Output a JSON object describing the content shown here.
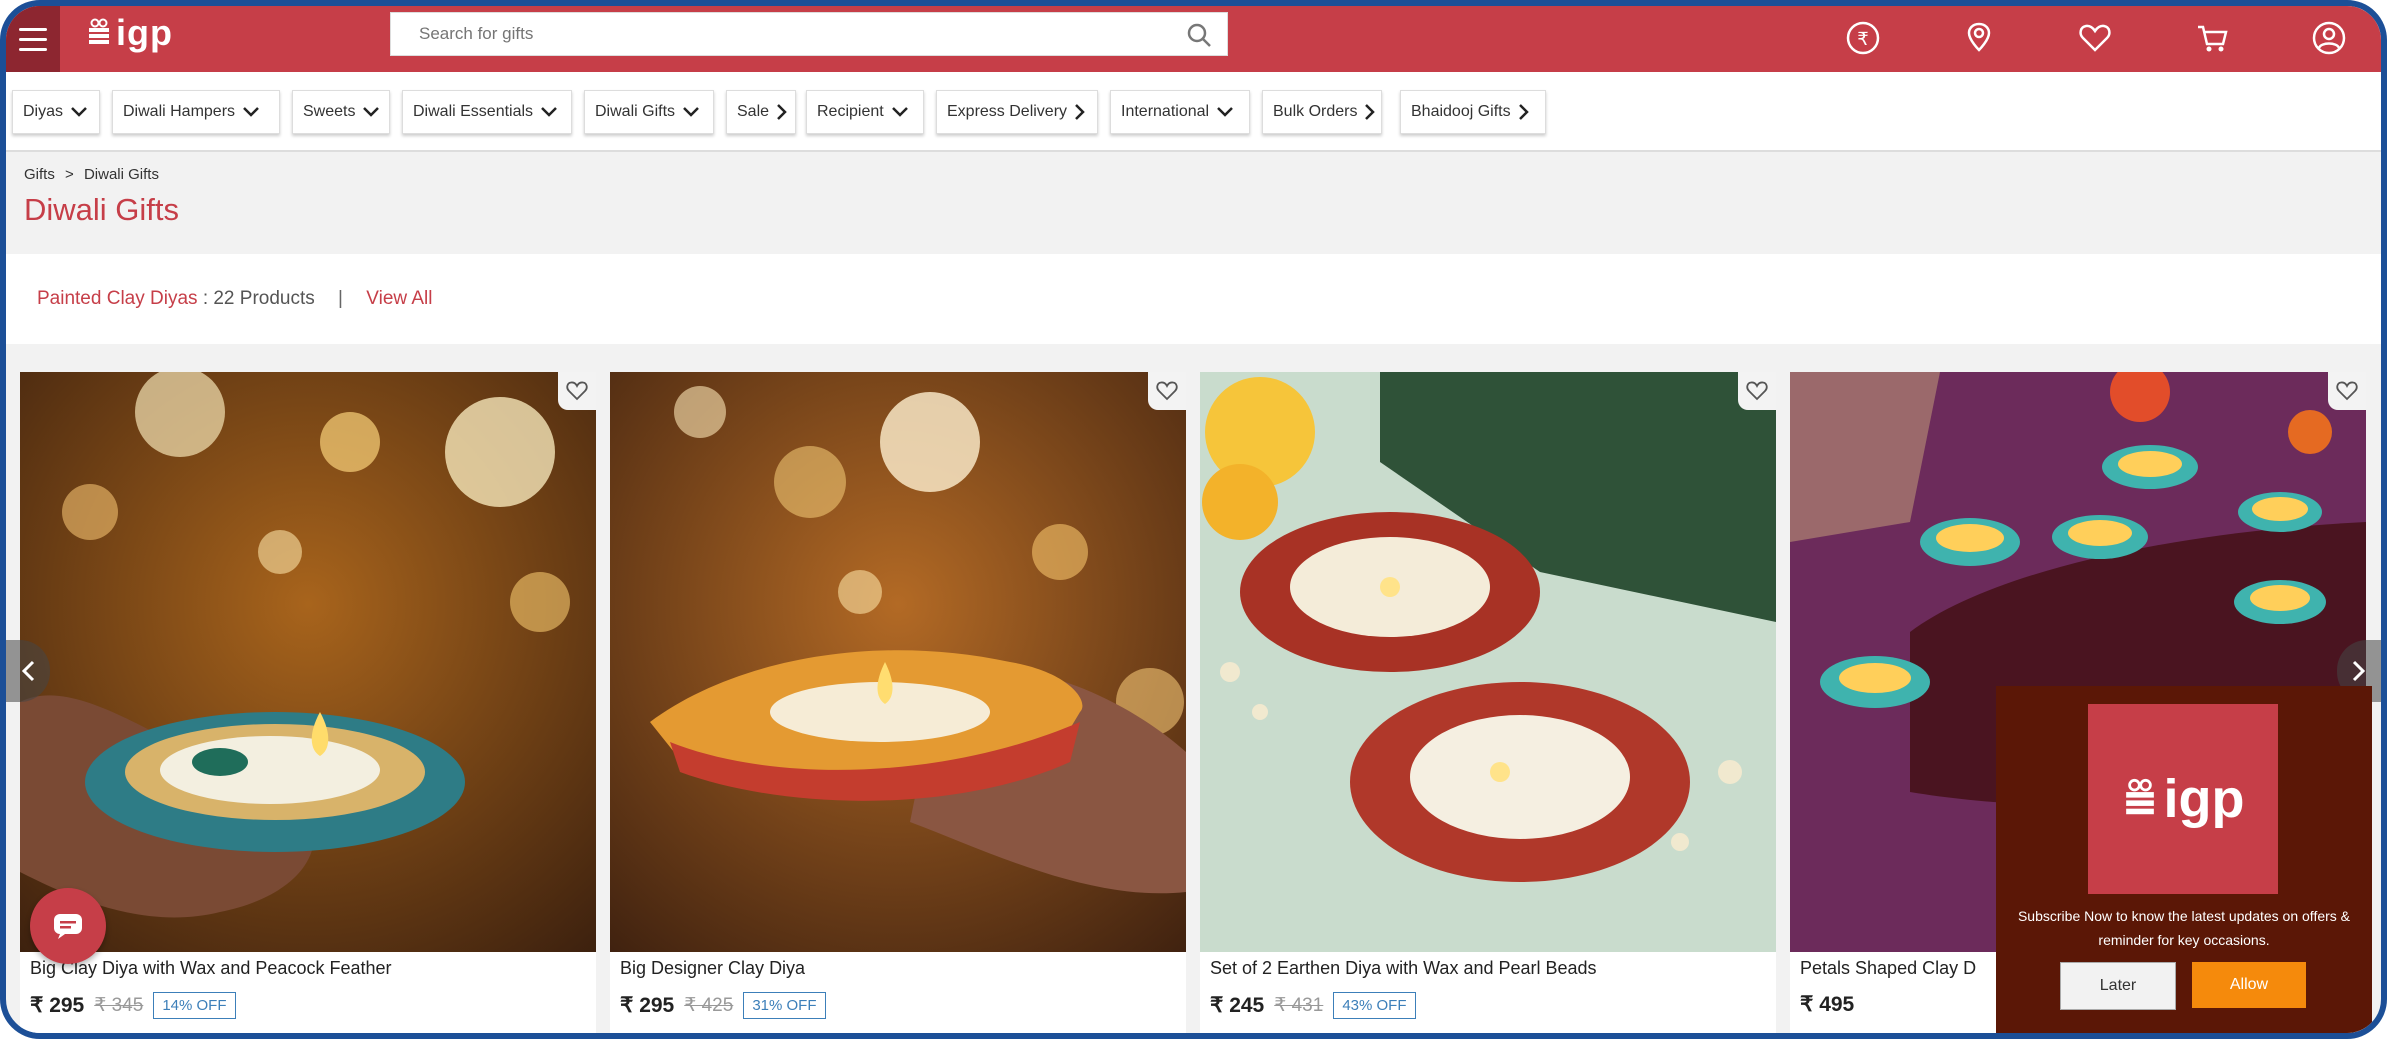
{
  "header": {
    "logo_text": "igp",
    "search_placeholder": "Search for gifts",
    "icons": [
      "menu-icon",
      "rupee-icon",
      "location-icon",
      "heart-icon",
      "cart-icon",
      "user-icon"
    ]
  },
  "nav": {
    "items": [
      {
        "label": "Diyas",
        "icon": "chevron-down"
      },
      {
        "label": "Diwali Hampers",
        "icon": "chevron-down"
      },
      {
        "label": "Sweets",
        "icon": "chevron-down"
      },
      {
        "label": "Diwali Essentials",
        "icon": "chevron-down"
      },
      {
        "label": "Diwali Gifts",
        "icon": "chevron-down"
      },
      {
        "label": "Sale",
        "icon": "chevron-right"
      },
      {
        "label": "Recipient",
        "icon": "chevron-down"
      },
      {
        "label": "Express Delivery",
        "icon": "chevron-right"
      },
      {
        "label": "International",
        "icon": "chevron-down"
      },
      {
        "label": "Bulk Orders",
        "icon": "chevron-right"
      },
      {
        "label": "Bhaidooj Gifts",
        "icon": "chevron-right"
      }
    ]
  },
  "breadcrumb": {
    "home": "Gifts",
    "separator": ">",
    "current": "Diwali Gifts"
  },
  "page_title": "Diwali Gifts",
  "category": {
    "name": "Painted Clay Diyas",
    "count": ": 22 Products",
    "separator": "|",
    "view_all": "View All"
  },
  "products": [
    {
      "name": "Big Clay Diya with Wax and Peacock Feather",
      "price": "₹ 295",
      "old_price": "₹ 345",
      "discount": "14% OFF"
    },
    {
      "name": "Big Designer Clay Diya",
      "price": "₹ 295",
      "old_price": "₹ 425",
      "discount": "31% OFF"
    },
    {
      "name": "Set of 2 Earthen Diya with Wax and Pearl Beads",
      "price": "₹ 245",
      "old_price": "₹ 431",
      "discount": "43% OFF"
    },
    {
      "name": "Petals Shaped Clay D",
      "price": "₹ 495",
      "old_price": "",
      "discount": ""
    }
  ],
  "popup": {
    "logo_text": "igp",
    "message": "Subscribe Now to know the latest updates on offers & reminder for key occasions.",
    "later": "Later",
    "allow": "Allow"
  },
  "colors": {
    "brand": "#c63e48",
    "frame": "#1c4f97",
    "allow": "#f58a0c",
    "popup_bg": "#5b1706"
  }
}
